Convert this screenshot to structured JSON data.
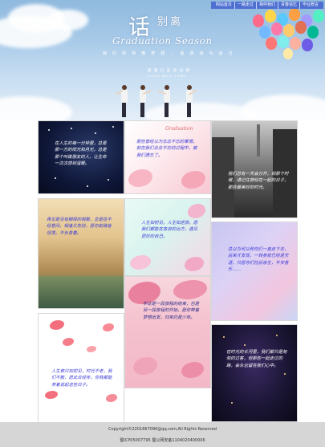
{
  "nav": {
    "items": [
      "网站首页",
      "一路走过",
      "相伴我们",
      "青春追忆",
      "毕业赠言"
    ]
  },
  "banner": {
    "title_big": "话",
    "title_small": "别离",
    "title_en": "Graduation Season",
    "slogan": "我 们 终 将 散 梦 想 ， 追 逐 诗 与 远 方",
    "sub_cn": "愿 我 们 前 程 似 锦",
    "sub_en": "GOOD  WILL  COME"
  },
  "cards": [
    {
      "id": "c1",
      "text": "在人生的每一分钟里，总是那一方的阳光和月光，总是那个叫做朋友的人，让生命一次次感到温暖。",
      "color": "#ffffff"
    },
    {
      "id": "c2",
      "text": "那些曾经以为念念不忘的事情，就在我们念念不忘的过程中，被我们遗忘了。",
      "color": "#3a3ad6",
      "tag": "Graduation"
    },
    {
      "id": "c3",
      "text": "我们总有一天会分开，到那个时候，请记住曾经在一起的日子，那些最美好的时光。",
      "color": "#ffffff"
    },
    {
      "id": "c4",
      "text": "再见是没有期限的相聚，总是在不经意间，相逢又告别，愿你前路皆坦荡，不负青春。",
      "color": "#3a3ad6"
    },
    {
      "id": "c5",
      "text": "人生如初见，人生如逆旅，愿我们都能在各自的远方，遇见更好的自己。",
      "color": "#3a3ad6"
    },
    {
      "id": "c6",
      "text": "总以为可以和你们一直走下去，后来才发现，一转身就已经是天涯，只愿你们往后余生，平安喜乐……",
      "color": "#3a3ad6"
    },
    {
      "id": "c7",
      "text": "毕业是一段旅程的结束，也是另一段旅程的开始，愿你带着梦想出发，归来仍是少年。",
      "color": "#2a2a8a"
    },
    {
      "id": "c8",
      "text": "人生若只如初见，时光不老，我们不散，愿此去经年，你我都能笑着说起这些日子。",
      "color": "#3a3ad6"
    },
    {
      "id": "c9",
      "text": "在时光的长河里，我们都只是匆匆的过客，但那些一起走过的路，会永远留在我们心中。",
      "color": "#ffffff"
    }
  ],
  "footer": {
    "copyright": "Copyright©2201667090@qq.com,All Rights Reserved",
    "icp": "蜀ICP05007795 蜀公网安备1104020400006"
  },
  "colors": {
    "nav_bg": "#4f6fd1",
    "card_text_blue": "#3a3ad6",
    "footer_bg": "#d6d6d6"
  }
}
